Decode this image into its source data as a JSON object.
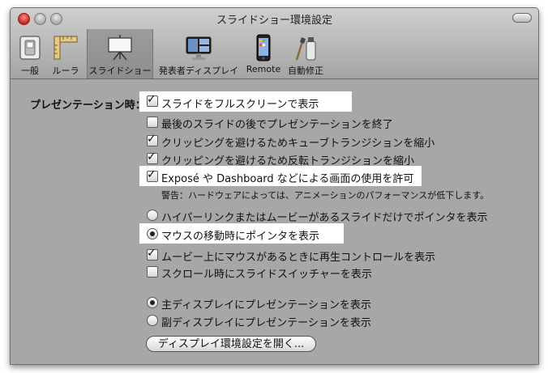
{
  "window": {
    "title": "スライドショー環境設定"
  },
  "toolbar": {
    "items": [
      {
        "label": "一般",
        "icon": "switch-icon"
      },
      {
        "label": "ルーラ",
        "icon": "ruler-icon"
      },
      {
        "label": "スライドショー",
        "icon": "projector-screen-icon",
        "selected": true
      },
      {
        "label": "発表者ディスプレイ",
        "icon": "monitor-icon"
      },
      {
        "label": "Remote",
        "icon": "iphone-icon"
      },
      {
        "label": "自動修正",
        "icon": "brush-bottle-icon"
      }
    ]
  },
  "presentation": {
    "section_label": "プレゼンテーション時：",
    "options": [
      {
        "label": "スライドをフルスクリーンで表示",
        "checked": true
      },
      {
        "label": "最後のスライドの後でプレゼンテーションを終了",
        "checked": false
      },
      {
        "label": "クリッピングを避けるためキューブトランジションを縮小",
        "checked": true
      },
      {
        "label": "クリッピングを避けるため反転トランジションを縮小",
        "checked": true
      },
      {
        "label": "Exposé や Dashboard などによる画面の使用を許可",
        "checked": true
      }
    ],
    "warning": "警告：ハードウェアによっては、アニメーションのパフォーマンスが低下します。",
    "pointer_radios": [
      {
        "label": "ハイパーリンクまたはムービーがあるスライドだけでポインタを表示",
        "selected": false
      },
      {
        "label": "マウスの移動時にポインタを表示",
        "selected": true
      }
    ],
    "extra_options": [
      {
        "label": "ムービー上にマウスがあるときに再生コントロールを表示",
        "checked": true
      },
      {
        "label": "スクロール時にスライドスイッチャーを表示",
        "checked": false
      }
    ],
    "display_radios": [
      {
        "label": "主ディスプレイにプレゼンテーションを表示",
        "selected": true
      },
      {
        "label": "副ディスプレイにプレゼンテーションを表示",
        "selected": false
      }
    ],
    "display_prefs_button": "ディスプレイ環境設定を開く..."
  }
}
